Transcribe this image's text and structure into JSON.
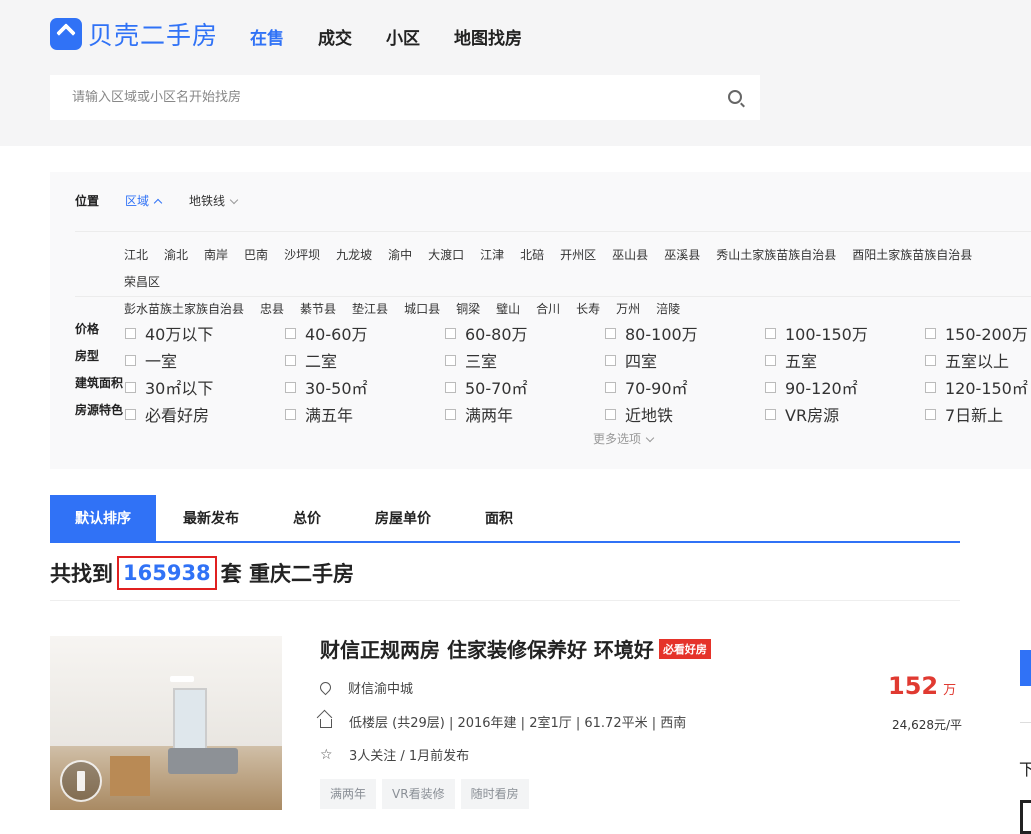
{
  "header": {
    "logo_text": "贝壳二手房",
    "nav": [
      {
        "label": "在售",
        "active": true
      },
      {
        "label": "成交",
        "active": false
      },
      {
        "label": "小区",
        "active": false
      },
      {
        "label": "地图找房",
        "active": false
      }
    ],
    "search_placeholder": "请输入区域或小区名开始找房"
  },
  "filters": {
    "position_label": "位置",
    "position_tabs": [
      {
        "label": "区域",
        "active": true
      },
      {
        "label": "地铁线",
        "active": false
      }
    ],
    "districts": [
      "江北",
      "渝北",
      "南岸",
      "巴南",
      "沙坪坝",
      "九龙坡",
      "渝中",
      "大渡口",
      "江津",
      "北碚",
      "开州区",
      "巫山县",
      "巫溪县",
      "秀山土家族苗族自治县",
      "酉阳土家族苗族自治县",
      "荣昌区",
      "彭水苗族土家族自治县",
      "忠县",
      "綦节县",
      "垫江县",
      "城口县",
      "铜梁",
      "璧山",
      "合川",
      "长寿",
      "万州",
      "涪陵"
    ],
    "rows": [
      {
        "label": "价格",
        "options": [
          "40万以下",
          "40-60万",
          "60-80万",
          "80-100万",
          "100-150万",
          "150-200万"
        ]
      },
      {
        "label": "房型",
        "options": [
          "一室",
          "二室",
          "三室",
          "四室",
          "五室",
          "五室以上"
        ]
      },
      {
        "label": "建筑面积",
        "options": [
          "30㎡以下",
          "30-50㎡",
          "50-70㎡",
          "70-90㎡",
          "90-120㎡",
          "120-150㎡"
        ]
      },
      {
        "label": "房源特色",
        "options": [
          "必看好房",
          "满五年",
          "满两年",
          "近地铁",
          "VR房源",
          "7日新上"
        ]
      }
    ],
    "more_label": "更多选项"
  },
  "sort_tabs": [
    {
      "label": "默认排序",
      "active": true
    },
    {
      "label": "最新发布",
      "active": false
    },
    {
      "label": "总价",
      "active": false
    },
    {
      "label": "房屋单价",
      "active": false
    },
    {
      "label": "面积",
      "active": false
    }
  ],
  "result": {
    "prefix": "共找到",
    "count": "165938",
    "suffix": "套 重庆二手房"
  },
  "listing": {
    "title": "财信正规两房 住家装修保养好 环境好",
    "badge": "必看好房",
    "community": "财信渝中城",
    "house_info": "低楼层 (共29层) | 2016年建 | 2室1厅 | 61.72平米 | 西南",
    "follow_info": "3人关注 / 1月前发布",
    "tags": [
      "满两年",
      "VR看装修",
      "随时看房"
    ],
    "total_price": "152",
    "price_unit": "万",
    "unit_price": "24,628元/平"
  },
  "side": {
    "text_fragment": "下"
  },
  "colors": {
    "brand": "#3072f6",
    "price": "#e03a31",
    "badge": "#e5332a",
    "count_outline": "#e02020"
  }
}
